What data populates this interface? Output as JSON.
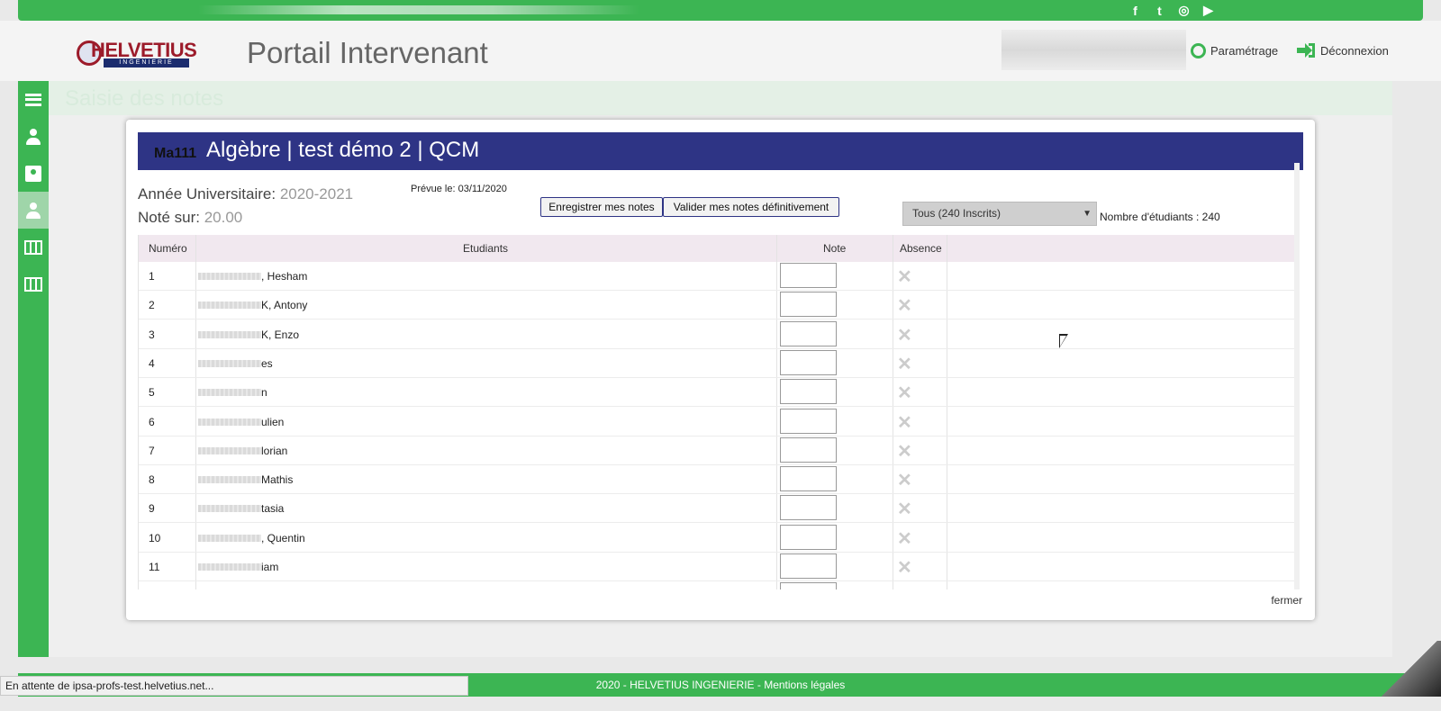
{
  "header": {
    "portal_title": "Portail Intervenant",
    "logo_text": "HELVETIUS",
    "logo_sub": "INGENIERIE",
    "param_label": "Paramétrage",
    "logout_label": "Déconnexion"
  },
  "social_icons": [
    "facebook-icon",
    "twitter-icon",
    "instagram-icon",
    "youtube-icon"
  ],
  "sidebar": {
    "items": [
      {
        "icon": "menu-icon"
      },
      {
        "icon": "user-icon"
      },
      {
        "icon": "id-badge-icon"
      },
      {
        "icon": "users-icon"
      },
      {
        "icon": "map-icon"
      },
      {
        "icon": "map-icon"
      }
    ]
  },
  "page_bg_title": "Saisie des notes",
  "modal": {
    "code": "Ma111",
    "title": "Algèbre | test démo 2 | QCM",
    "annee_label": "Année Universitaire:",
    "annee_value": "2020-2021",
    "note_label": "Noté sur:",
    "note_value": "20.00",
    "prevue": "Prévue le: 03/11/2020",
    "btn_save": "Enregistrer mes notes",
    "btn_validate": "Valider mes notes définitivement",
    "filter_selected": "Tous (240 Inscrits)",
    "student_count": "Nombre d'étudiants : 240",
    "columns": {
      "numero": "Numéro",
      "etudiants": "Etudiants",
      "note": "Note",
      "absence": "Absence"
    },
    "rows": [
      {
        "num": "1",
        "name": ", Hesham"
      },
      {
        "num": "2",
        "name": "K, Antony"
      },
      {
        "num": "3",
        "name": "K, Enzo"
      },
      {
        "num": "4",
        "name": "es"
      },
      {
        "num": "5",
        "name": "n"
      },
      {
        "num": "6",
        "name": "ulien"
      },
      {
        "num": "7",
        "name": "lorian"
      },
      {
        "num": "8",
        "name": "Mathis"
      },
      {
        "num": "9",
        "name": "tasia"
      },
      {
        "num": "10",
        "name": ", Quentin"
      },
      {
        "num": "11",
        "name": "iam"
      }
    ],
    "absence_mark": "✕",
    "close_label": "fermer"
  },
  "footer": {
    "text": "2020 - HELVETIUS INGENIERIE - Mentions légales"
  },
  "status_bar": "En attente de ipsa-profs-test.helvetius.net...",
  "colors": {
    "green": "#3cb553",
    "navy": "#2e3485",
    "burgundy": "#9c1b2a"
  }
}
